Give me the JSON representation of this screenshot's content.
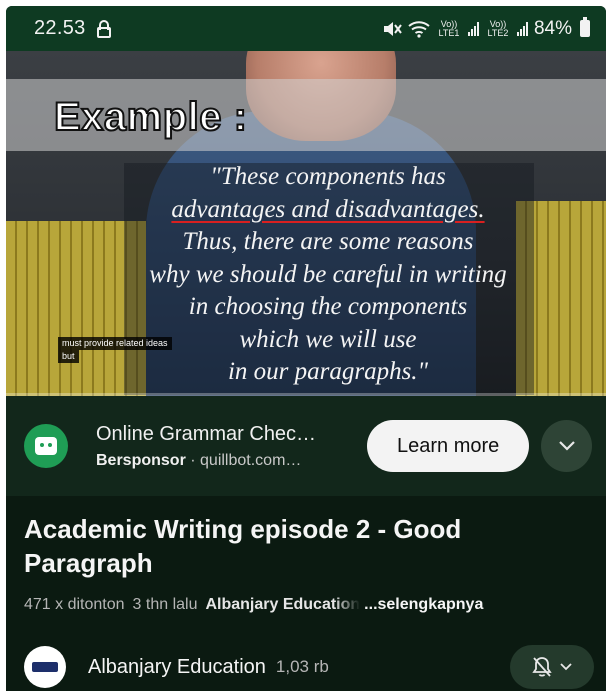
{
  "status_bar": {
    "time": "22.53",
    "sim1_label": "Vo)) LTE1",
    "sim2_label": "Vo)) LTE2",
    "battery": "84%"
  },
  "video": {
    "heading": "Example :",
    "quote_lines": [
      "\"These components has",
      "advantages and disadvantages.",
      "Thus, there are some reasons",
      "why we should be careful in writing",
      "in choosing the components",
      "which we will use",
      "in our paragraphs.\""
    ],
    "caption_line1": "must provide related ideas",
    "caption_line2": "but"
  },
  "ad": {
    "title": "Online Grammar Chec…",
    "sponsor": "Bersponsor",
    "domain": "quillbot.com…",
    "cta": "Learn more"
  },
  "info": {
    "title": "Academic Writing episode 2 - Good Paragraph",
    "views": "471 x ditonton",
    "age": "3 thn lalu",
    "channel_tag": "Albanjary Education",
    "more": "...selengkapnya",
    "channel_name": "Albanjary Education",
    "subscribers": "1,03 rb"
  }
}
